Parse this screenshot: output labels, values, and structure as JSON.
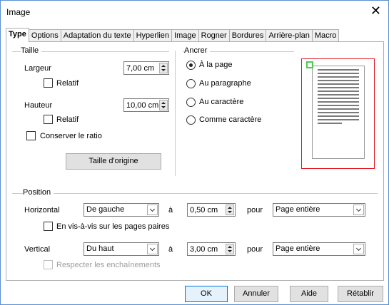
{
  "window": {
    "title": "Image",
    "close_glyph": "✕"
  },
  "tabs": [
    {
      "label": "Type",
      "active": true
    },
    {
      "label": "Options",
      "active": false
    },
    {
      "label": "Adaptation du texte",
      "active": false
    },
    {
      "label": "Hyperlien",
      "active": false
    },
    {
      "label": "Image",
      "active": false
    },
    {
      "label": "Rogner",
      "active": false
    },
    {
      "label": "Bordures",
      "active": false
    },
    {
      "label": "Arrière-plan",
      "active": false
    },
    {
      "label": "Macro",
      "active": false
    }
  ],
  "size": {
    "group_label": "Taille",
    "width_label": "Largeur",
    "width_value": "7,00 cm",
    "width_relative_label": "Relatif",
    "height_label": "Hauteur",
    "height_value": "10,00 cm",
    "height_relative_label": "Relatif",
    "keep_ratio_label": "Conserver le ratio",
    "original_size_button": "Taille d'origine"
  },
  "anchor": {
    "group_label": "Ancrer",
    "options": [
      {
        "label": "À la page",
        "checked": true
      },
      {
        "label": "Au paragraphe",
        "checked": false
      },
      {
        "label": "Au caractère",
        "checked": false
      },
      {
        "label": "Comme caractère",
        "checked": false
      }
    ]
  },
  "position": {
    "group_label": "Position",
    "horizontal_label": "Horizontal",
    "horizontal_value": "De gauche",
    "horizontal_at_label": "à",
    "horizontal_offset": "0,50 cm",
    "horizontal_for_label": "pour",
    "horizontal_relation": "Page entière",
    "mirror_label": "En vis-à-vis sur les pages paires",
    "vertical_label": "Vertical",
    "vertical_value": "Du haut",
    "vertical_at_label": "à",
    "vertical_offset": "3,00 cm",
    "vertical_for_label": "pour",
    "vertical_relation": "Page entière",
    "follow_flow_label": "Respecter les enchaînements"
  },
  "buttons": {
    "ok": "OK",
    "cancel": "Annuler",
    "help": "Aide",
    "reset": "Rétablir"
  },
  "colors": {
    "preview_border": "#e0141e",
    "anchor_marker": "#4ccc4c",
    "default_button": "#0078d7"
  }
}
